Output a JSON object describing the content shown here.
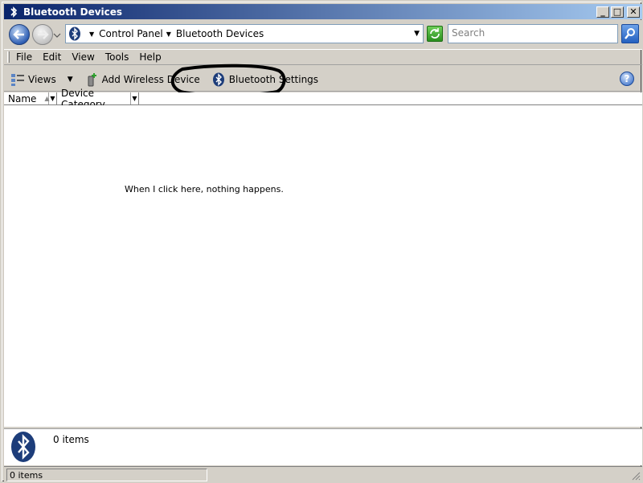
{
  "window": {
    "title": "Bluetooth Devices",
    "minimize_label": "_",
    "maximize_label": "□",
    "close_label": "✕"
  },
  "address_bar": {
    "breadcrumb": [
      "Control Panel",
      "Bluetooth Devices"
    ],
    "search_placeholder": "Search"
  },
  "menubar": {
    "items": [
      {
        "label": "File"
      },
      {
        "label": "Edit"
      },
      {
        "label": "View"
      },
      {
        "label": "Tools"
      },
      {
        "label": "Help"
      }
    ]
  },
  "toolbar": {
    "views_label": "Views",
    "add_device_label": "Add Wireless Device",
    "bt_settings_label": "Bluetooth Settings",
    "help_label": "?"
  },
  "columns": [
    {
      "label": "Name"
    },
    {
      "label": "Device Category"
    }
  ],
  "annotation": {
    "text": "When I click here, nothing happens."
  },
  "details_pane": {
    "count_text": "0 items"
  },
  "status_bar": {
    "text": "0 items"
  },
  "colors": {
    "title_start": "#0a246a",
    "title_end": "#a6caf0",
    "bluetooth_blue": "#1d3d7a"
  }
}
